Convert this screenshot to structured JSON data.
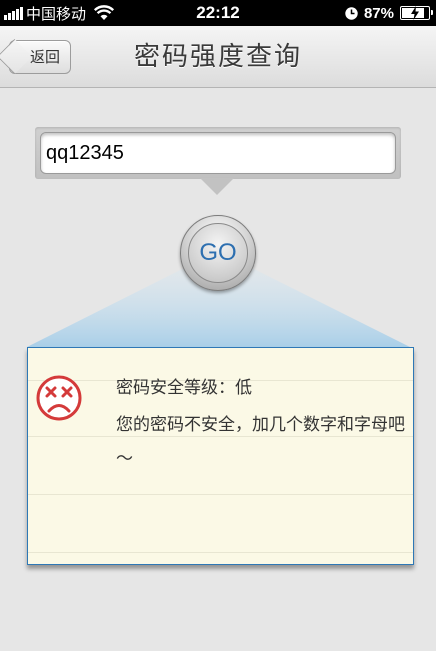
{
  "status_bar": {
    "carrier": "中国移动",
    "time": "22:12",
    "battery_percent": "87%",
    "battery_level": 0.87,
    "icons": [
      "signal-icon",
      "wifi-icon",
      "clock-icon",
      "battery-icon"
    ]
  },
  "nav": {
    "back_label": "返回",
    "title": "密码强度查询"
  },
  "input": {
    "value": "qq12345"
  },
  "go_button": {
    "label": "GO"
  },
  "result": {
    "icon": "sad-face-icon",
    "level_text": "密码安全等级：低",
    "message": "您的密码不安全，加几个数字和字母吧～",
    "colors": {
      "face": "#d43a3a",
      "border": "#2e78b6",
      "card": "#fbf9e6"
    }
  },
  "colors": {
    "accent": "#2d6fb0",
    "beam": "#a9cfe8"
  }
}
